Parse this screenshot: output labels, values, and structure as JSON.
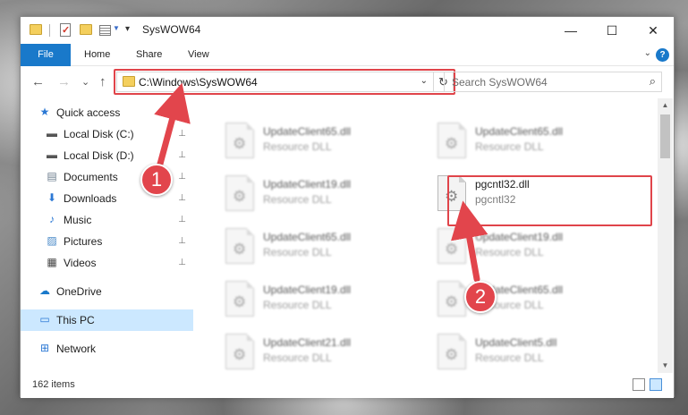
{
  "window": {
    "title": "SysWOW64",
    "controls": {
      "minimize": "—",
      "maximize": "☐",
      "close": "✕"
    }
  },
  "ribbon": {
    "tabs": [
      "File",
      "Home",
      "Share",
      "View"
    ],
    "expand_icon": "chevron-down-icon",
    "help_icon": "?"
  },
  "nav": {
    "back": "←",
    "forward": "→",
    "recent": "⌄",
    "up": "↑",
    "address": "C:\\Windows\\SysWOW64",
    "search_placeholder": "Search SysWOW64"
  },
  "sidebar": {
    "items": [
      {
        "label": "Quick access",
        "icon": "star-icon",
        "glyph": "★",
        "color": "#2b78d4",
        "pinned": false
      },
      {
        "label": "Local Disk (C:)",
        "icon": "drive-icon",
        "glyph": "▬",
        "color": "#555555",
        "pinned": true
      },
      {
        "label": "Local Disk (D:)",
        "icon": "drive-icon",
        "glyph": "▬",
        "color": "#555555",
        "pinned": true
      },
      {
        "label": "Documents",
        "icon": "document-icon",
        "glyph": "▤",
        "color": "#6a7b8c",
        "pinned": true
      },
      {
        "label": "Downloads",
        "icon": "download-icon",
        "glyph": "⬇",
        "color": "#2b78d4",
        "pinned": true
      },
      {
        "label": "Music",
        "icon": "music-icon",
        "glyph": "♪",
        "color": "#2b78d4",
        "pinned": true
      },
      {
        "label": "Pictures",
        "icon": "picture-icon",
        "glyph": "▨",
        "color": "#4a8ac8",
        "pinned": true
      },
      {
        "label": "Videos",
        "icon": "video-icon",
        "glyph": "▦",
        "color": "#444444",
        "pinned": true
      },
      {
        "label": "OneDrive",
        "icon": "cloud-icon",
        "glyph": "☁",
        "color": "#1979ca",
        "pinned": false
      },
      {
        "label": "This PC",
        "icon": "computer-icon",
        "glyph": "▭",
        "color": "#2b78d4",
        "pinned": false
      },
      {
        "label": "Network",
        "icon": "network-icon",
        "glyph": "⊞",
        "color": "#2b78d4",
        "pinned": false
      }
    ]
  },
  "files": [
    {
      "name": "UpdateClient65.dll",
      "desc": "Resource DLL",
      "blurred": true
    },
    {
      "name": "UpdateClient65.dll",
      "desc": "Resource DLL",
      "blurred": true
    },
    {
      "name": "UpdateClient19.dll",
      "desc": "Resource DLL",
      "blurred": true
    },
    {
      "name": "pgcntl32.dll",
      "desc": "pgcntl32",
      "blurred": false
    },
    {
      "name": "UpdateClient65.dll",
      "desc": "Resource DLL",
      "blurred": true
    },
    {
      "name": "UpdateClient19.dll",
      "desc": "Resource DLL",
      "blurred": true
    },
    {
      "name": "UpdateClient19.dll",
      "desc": "Resource DLL",
      "blurred": true
    },
    {
      "name": "UpdateClient65.dll",
      "desc": "Resource DLL",
      "blurred": true
    },
    {
      "name": "UpdateClient21.dll",
      "desc": "Resource DLL",
      "blurred": true
    },
    {
      "name": "UpdateClient5.dll",
      "desc": "Resource DLL",
      "blurred": true
    }
  ],
  "status": {
    "item_count": "162 items"
  },
  "annotations": {
    "callout_1": "1",
    "callout_2": "2",
    "highlight_color": "#e0444a"
  }
}
